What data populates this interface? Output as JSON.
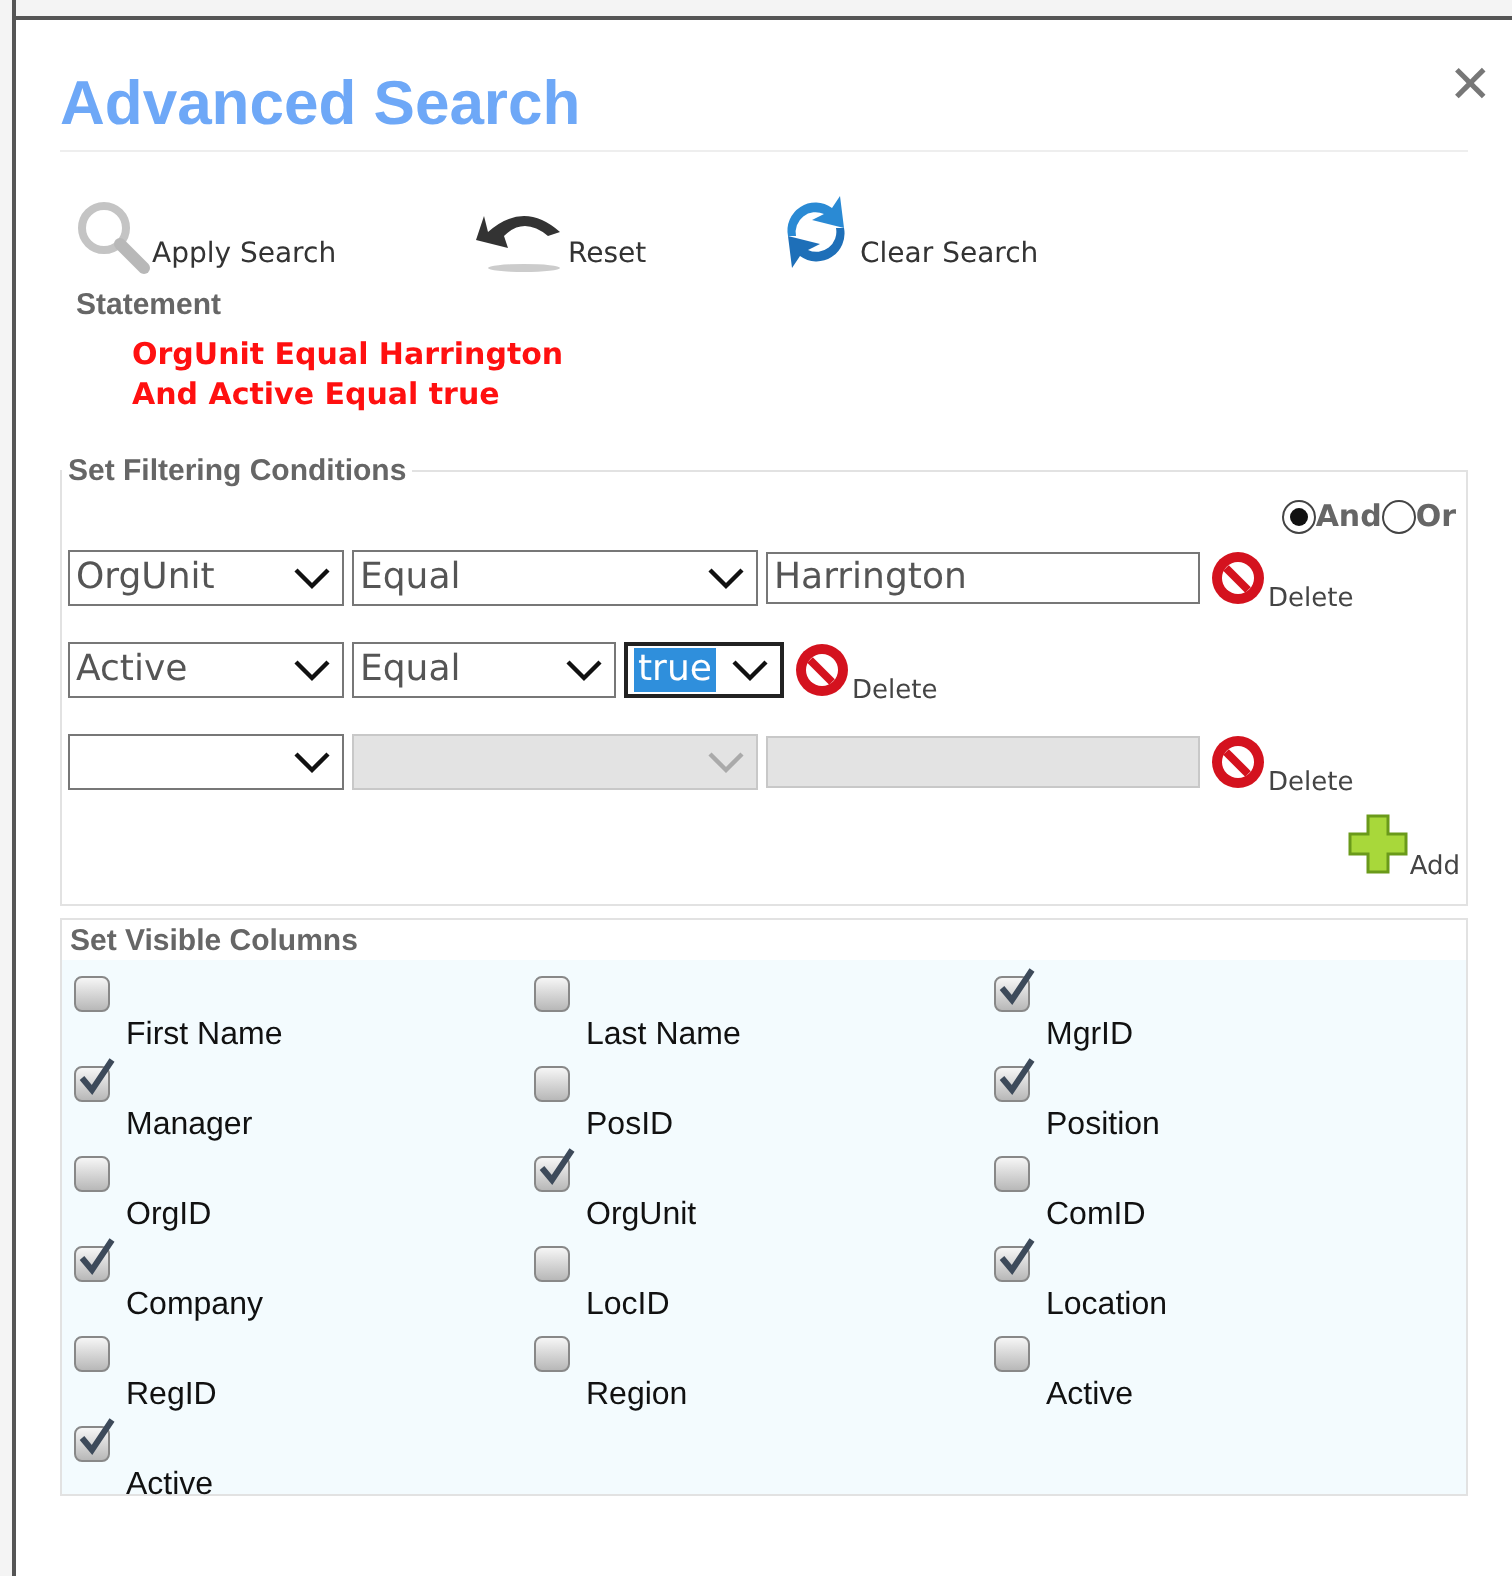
{
  "dialog": {
    "title": "Advanced Search",
    "close": "✕"
  },
  "toolbar": [
    {
      "kind": "search",
      "label": "Apply Search"
    },
    {
      "kind": "reset",
      "label": "Reset"
    },
    {
      "kind": "clear",
      "label": "Clear Search"
    }
  ],
  "statement": {
    "label": "Statement",
    "lines": [
      "OrgUnit Equal Harrington",
      "And Active Equal true"
    ]
  },
  "filtering": {
    "legend": "Set Filtering Conditions",
    "logic": [
      {
        "label": "And",
        "selected": true
      },
      {
        "label": "Or",
        "selected": false
      }
    ],
    "conditions": [
      {
        "field": "OrgUnit",
        "operator": "Equal",
        "value": "Harrington",
        "kind": "text",
        "disabled": false,
        "focused": false,
        "delete": "Delete"
      },
      {
        "field": "Active",
        "operator": "Equal",
        "value": "true",
        "kind": "select",
        "disabled": false,
        "focused": true,
        "delete": "Delete"
      },
      {
        "kind": "text",
        "disabled": true,
        "focused": false,
        "delete": "Delete"
      }
    ],
    "add": "Add"
  },
  "columns": {
    "legend": "Set Visible Columns",
    "items": [
      {
        "label": "First Name",
        "checked": false
      },
      {
        "label": "Last Name",
        "checked": false
      },
      {
        "label": "MgrID",
        "checked": true
      },
      {
        "label": "Manager",
        "checked": true
      },
      {
        "label": "PosID",
        "checked": false
      },
      {
        "label": "Position",
        "checked": true
      },
      {
        "label": "OrgID",
        "checked": false
      },
      {
        "label": "OrgUnit",
        "checked": true
      },
      {
        "label": "ComID",
        "checked": false
      },
      {
        "label": "Company",
        "checked": true
      },
      {
        "label": "LocID",
        "checked": false
      },
      {
        "label": "Location",
        "checked": true
      },
      {
        "label": "RegID",
        "checked": false
      },
      {
        "label": "Region",
        "checked": false
      },
      {
        "label": "Active",
        "checked": false
      },
      {
        "label": "Active",
        "checked": true
      }
    ]
  }
}
